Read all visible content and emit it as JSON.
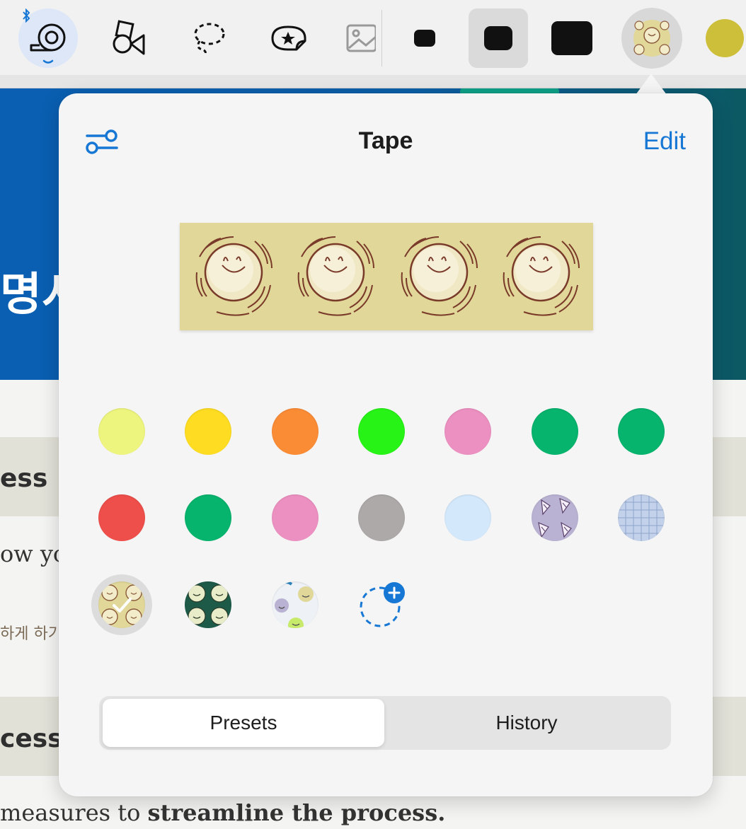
{
  "toolbar": {
    "tools": [
      {
        "name": "tape-tool",
        "icon": "tape-icon",
        "selected": true,
        "bluetooth": true
      },
      {
        "name": "shapes-tool",
        "icon": "shapes-icon"
      },
      {
        "name": "lasso-tool",
        "icon": "lasso-icon"
      },
      {
        "name": "sticker-tool",
        "icon": "sticker-icon"
      },
      {
        "name": "image-tool",
        "icon": "image-icon"
      }
    ],
    "sizes": [
      "small",
      "medium",
      "large"
    ],
    "selected_size": "medium",
    "colors": [
      {
        "name": "pattern-smiley-swatch",
        "selected": true
      },
      {
        "name": "yellow-swatch",
        "hex": "#cdbf3a"
      }
    ]
  },
  "background": {
    "banner_text": "명시",
    "heading1": "ess",
    "text1": "ow yo",
    "text2": "하게 하기",
    "heading2": "cess",
    "text3": " measures to ",
    "text3_bold": "streamline the process."
  },
  "popover": {
    "title": "Tape",
    "edit_label": "Edit",
    "preview_pattern": "smiley-dumpling",
    "swatches": [
      {
        "type": "color",
        "hex": "#eef57e"
      },
      {
        "type": "color",
        "hex": "#fddc22"
      },
      {
        "type": "color",
        "hex": "#fb8c36"
      },
      {
        "type": "color",
        "hex": "#27f317"
      },
      {
        "type": "color",
        "hex": "#ec90c1"
      },
      {
        "type": "color",
        "hex": "#07b46d"
      },
      {
        "type": "color",
        "hex": "#07b46d"
      },
      {
        "type": "color",
        "hex": "#ee4f4b"
      },
      {
        "type": "color",
        "hex": "#07b46d"
      },
      {
        "type": "color",
        "hex": "#ec90c1"
      },
      {
        "type": "color",
        "hex": "#ada9a8"
      },
      {
        "type": "color",
        "hex": "#d3e8fb"
      },
      {
        "type": "pattern",
        "pattern": "lavender-flowers"
      },
      {
        "type": "pattern",
        "pattern": "blue-grid"
      },
      {
        "type": "pattern",
        "pattern": "smiley-dumpling",
        "selected": true
      },
      {
        "type": "pattern",
        "pattern": "green-cats"
      },
      {
        "type": "pattern",
        "pattern": "smiley-faces"
      }
    ],
    "add_icon": "add-pattern-icon",
    "tabs": [
      {
        "label": "Presets",
        "active": true
      },
      {
        "label": "History",
        "active": false
      }
    ]
  },
  "colors": {
    "accent": "#1677d4",
    "banner": "#0a5fb3",
    "selected_toolbar_yellow": "#cdbf3a"
  }
}
